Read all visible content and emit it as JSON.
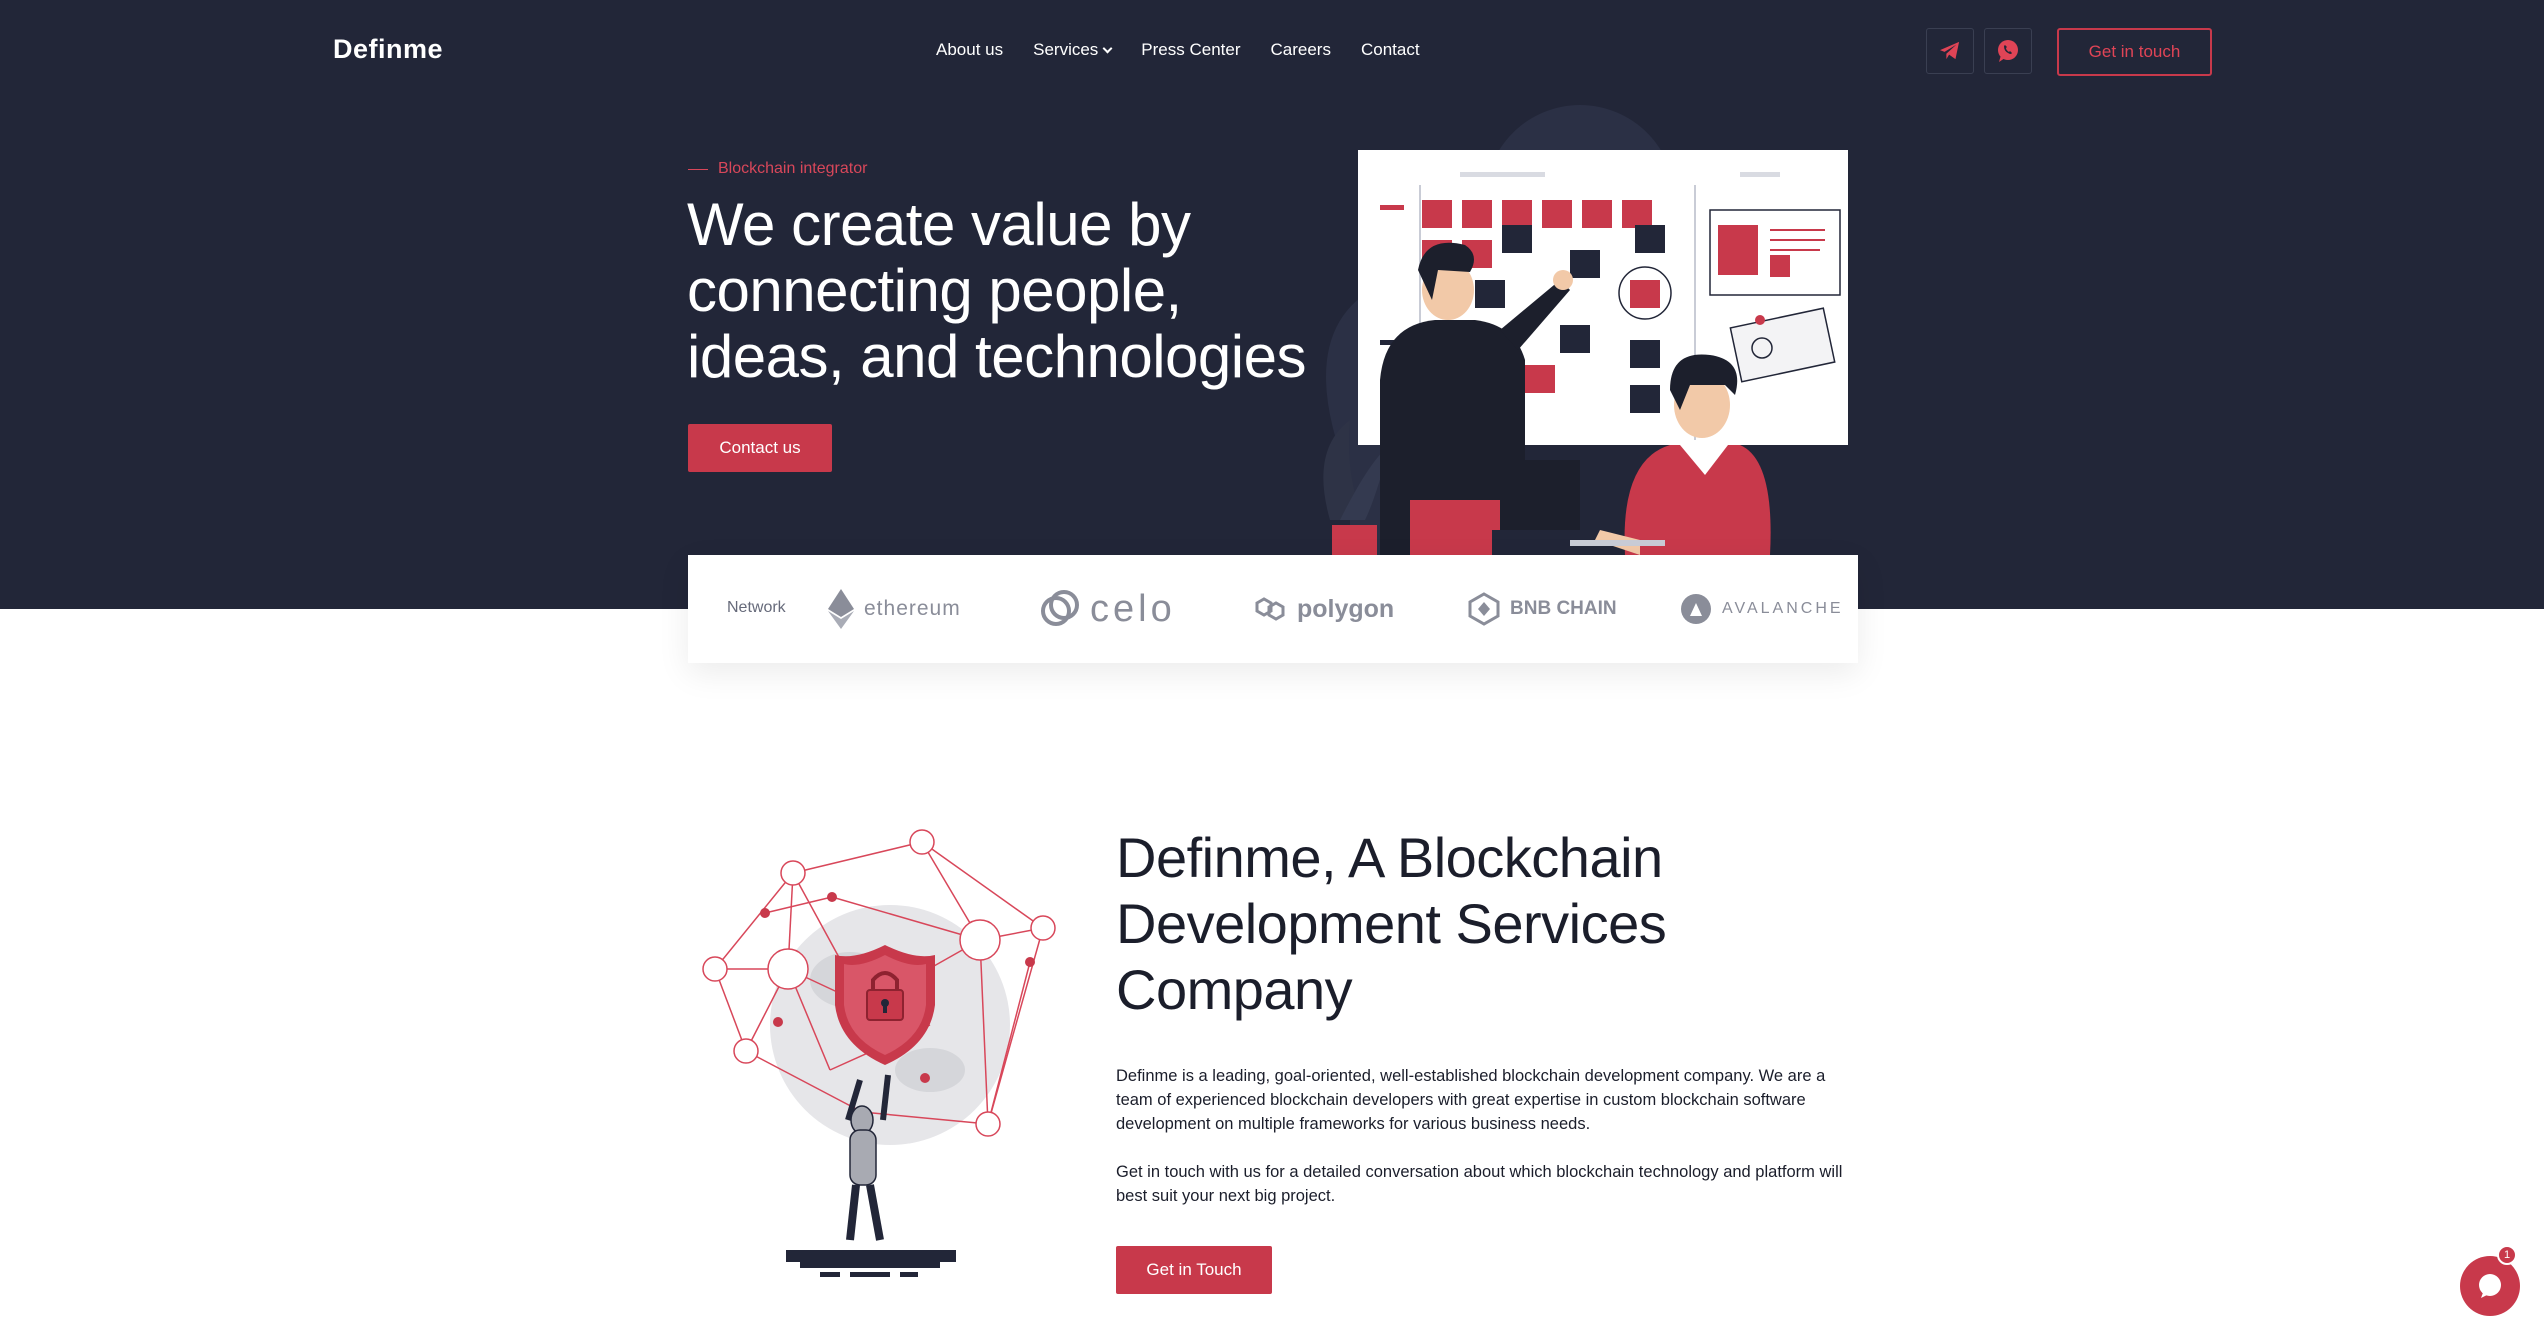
{
  "brand": {
    "logo": "Definme"
  },
  "nav": {
    "items": [
      "About us",
      "Services",
      "Press Center",
      "Careers",
      "Contact"
    ],
    "get_in_touch": "Get in touch"
  },
  "hero": {
    "eyebrow": "Blockchain integrator",
    "title": "We create value by connecting people, ideas, and technologies",
    "button": "Contact us"
  },
  "network": {
    "label": "Network",
    "brands": [
      "ethereum",
      "celo",
      "polygon",
      "BNB CHAIN",
      "AVALANCHE"
    ]
  },
  "about": {
    "title": "Definme, A Blockchain Development Services Company",
    "paragraph1": "Definme is a leading, goal-oriented, well-established blockchain development company. We are a team of experienced blockchain developers with great expertise in custom blockchain software development on multiple frameworks for various business needs.",
    "paragraph2": "Get in touch with us for a detailed conversation about which blockchain technology and platform will best suit your next big project.",
    "button": "Get in Touch"
  },
  "chat": {
    "badge": "1"
  },
  "colors": {
    "dark": "#222638",
    "accent": "#c8394b",
    "white": "#ffffff"
  },
  "icons": [
    "telegram-icon",
    "whatsapp-icon",
    "chevron-down-icon",
    "chat-icon"
  ]
}
